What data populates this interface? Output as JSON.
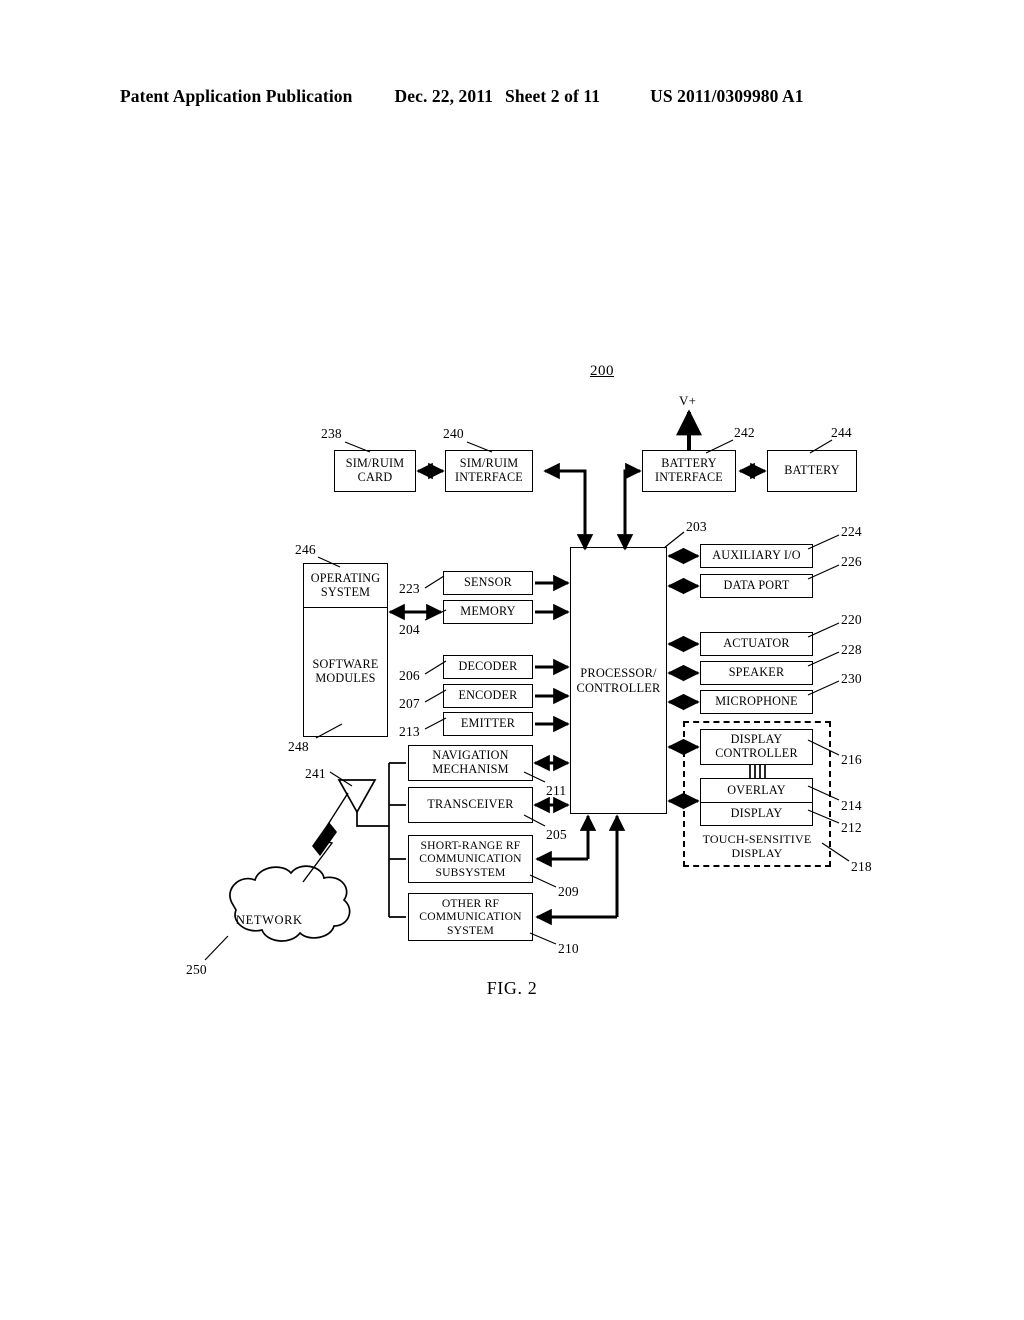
{
  "header": {
    "publication": "Patent Application Publication",
    "date": "Dec. 22, 2011",
    "sheet": "Sheet 2 of 11",
    "number": "US 2011/0309980 A1"
  },
  "figure": {
    "system_number": "200",
    "label": "FIG. 2",
    "power_label": "V+"
  },
  "blocks": {
    "sim_card": {
      "label": "SIM/RUIM\nCARD",
      "ref": "238"
    },
    "sim_interface": {
      "label": "SIM/RUIM\nINTERFACE",
      "ref": "240"
    },
    "battery_interface": {
      "label": "BATTERY\nINTERFACE",
      "ref": "242"
    },
    "battery": {
      "label": "BATTERY",
      "ref": "244"
    },
    "operating_system": {
      "label": "OPERATING\nSYSTEM",
      "ref": "246"
    },
    "software_modules": {
      "label": "SOFTWARE\nMODULES",
      "ref": "248"
    },
    "sensor": {
      "label": "SENSOR",
      "ref": "223"
    },
    "memory": {
      "label": "MEMORY",
      "ref": "204"
    },
    "decoder": {
      "label": "DECODER",
      "ref": "206"
    },
    "encoder": {
      "label": "ENCODER",
      "ref": "207"
    },
    "emitter": {
      "label": "EMITTER",
      "ref": "213"
    },
    "navigation_mechanism": {
      "label": "NAVIGATION\nMECHANISM",
      "ref": "211"
    },
    "transceiver": {
      "label": "TRANSCEIVER",
      "ref": "205"
    },
    "short_range_rf": {
      "label": "SHORT-RANGE RF\nCOMMUNICATION\nSUBSYSTEM",
      "ref": "209"
    },
    "other_rf": {
      "label": "OTHER RF\nCOMMUNICATION\nSYSTEM",
      "ref": "210"
    },
    "processor": {
      "label": "PROCESSOR/\nCONTROLLER",
      "ref": "203"
    },
    "auxiliary_io": {
      "label": "AUXILIARY I/O",
      "ref": "224"
    },
    "data_port": {
      "label": "DATA PORT",
      "ref": "226"
    },
    "actuator": {
      "label": "ACTUATOR",
      "ref": "220"
    },
    "speaker": {
      "label": "SPEAKER",
      "ref": "228"
    },
    "microphone": {
      "label": "MICROPHONE",
      "ref": "230"
    },
    "display_controller": {
      "label": "DISPLAY\nCONTROLLER",
      "ref": "216"
    },
    "overlay": {
      "label": "OVERLAY",
      "ref": "214"
    },
    "display": {
      "label": "DISPLAY",
      "ref": "212"
    },
    "touch_sensitive_display": {
      "label": "TOUCH-SENSITIVE\nDISPLAY",
      "ref": "218"
    },
    "antenna": {
      "ref": "241"
    },
    "network": {
      "label": "NETWORK",
      "ref": "250"
    }
  }
}
